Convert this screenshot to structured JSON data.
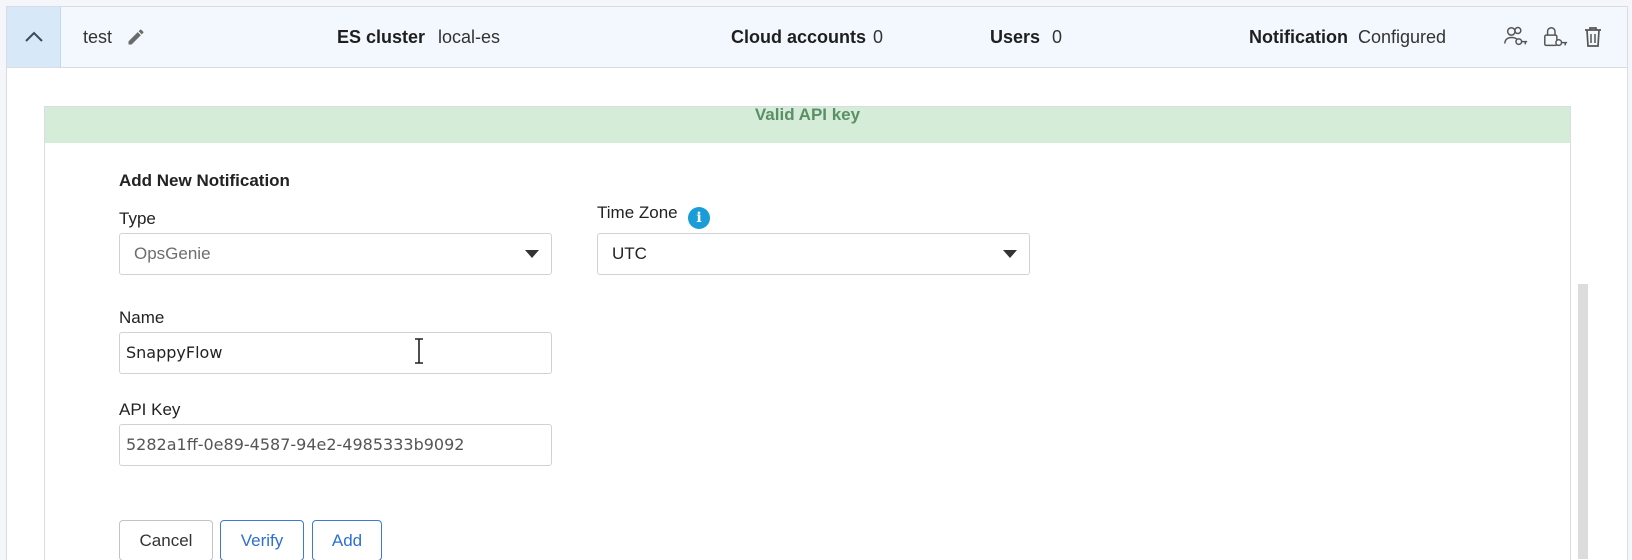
{
  "header": {
    "name": "test",
    "es_cluster_label": "ES cluster",
    "es_cluster_value": "local-es",
    "cloud_accounts_label": "Cloud accounts",
    "cloud_accounts_value": "0",
    "users_label": "Users",
    "users_value": "0",
    "notification_label": "Notification",
    "notification_value": "Configured",
    "icons": [
      "chevron-up-icon",
      "pencil-icon",
      "users-key-icon",
      "lock-key-icon",
      "trash-icon"
    ]
  },
  "banner": {
    "text": "Valid API key",
    "color": "#d5ecd9"
  },
  "form": {
    "title": "Add New Notification",
    "type_label": "Type",
    "type_value": "OpsGenie",
    "timezone_label": "Time Zone",
    "timezone_value": "UTC",
    "name_label": "Name",
    "name_value": "SnappyFlow",
    "api_key_label": "API Key",
    "api_key_value": "5282a1ff-0e89-4587-94e2-4985333b9092",
    "info_icon": "i"
  },
  "buttons": {
    "cancel": "Cancel",
    "verify": "Verify",
    "add": "Add"
  },
  "colors": {
    "accent": "#2d6fd3",
    "info": "#1a9cd8",
    "banner_text": "#5b8f65"
  }
}
